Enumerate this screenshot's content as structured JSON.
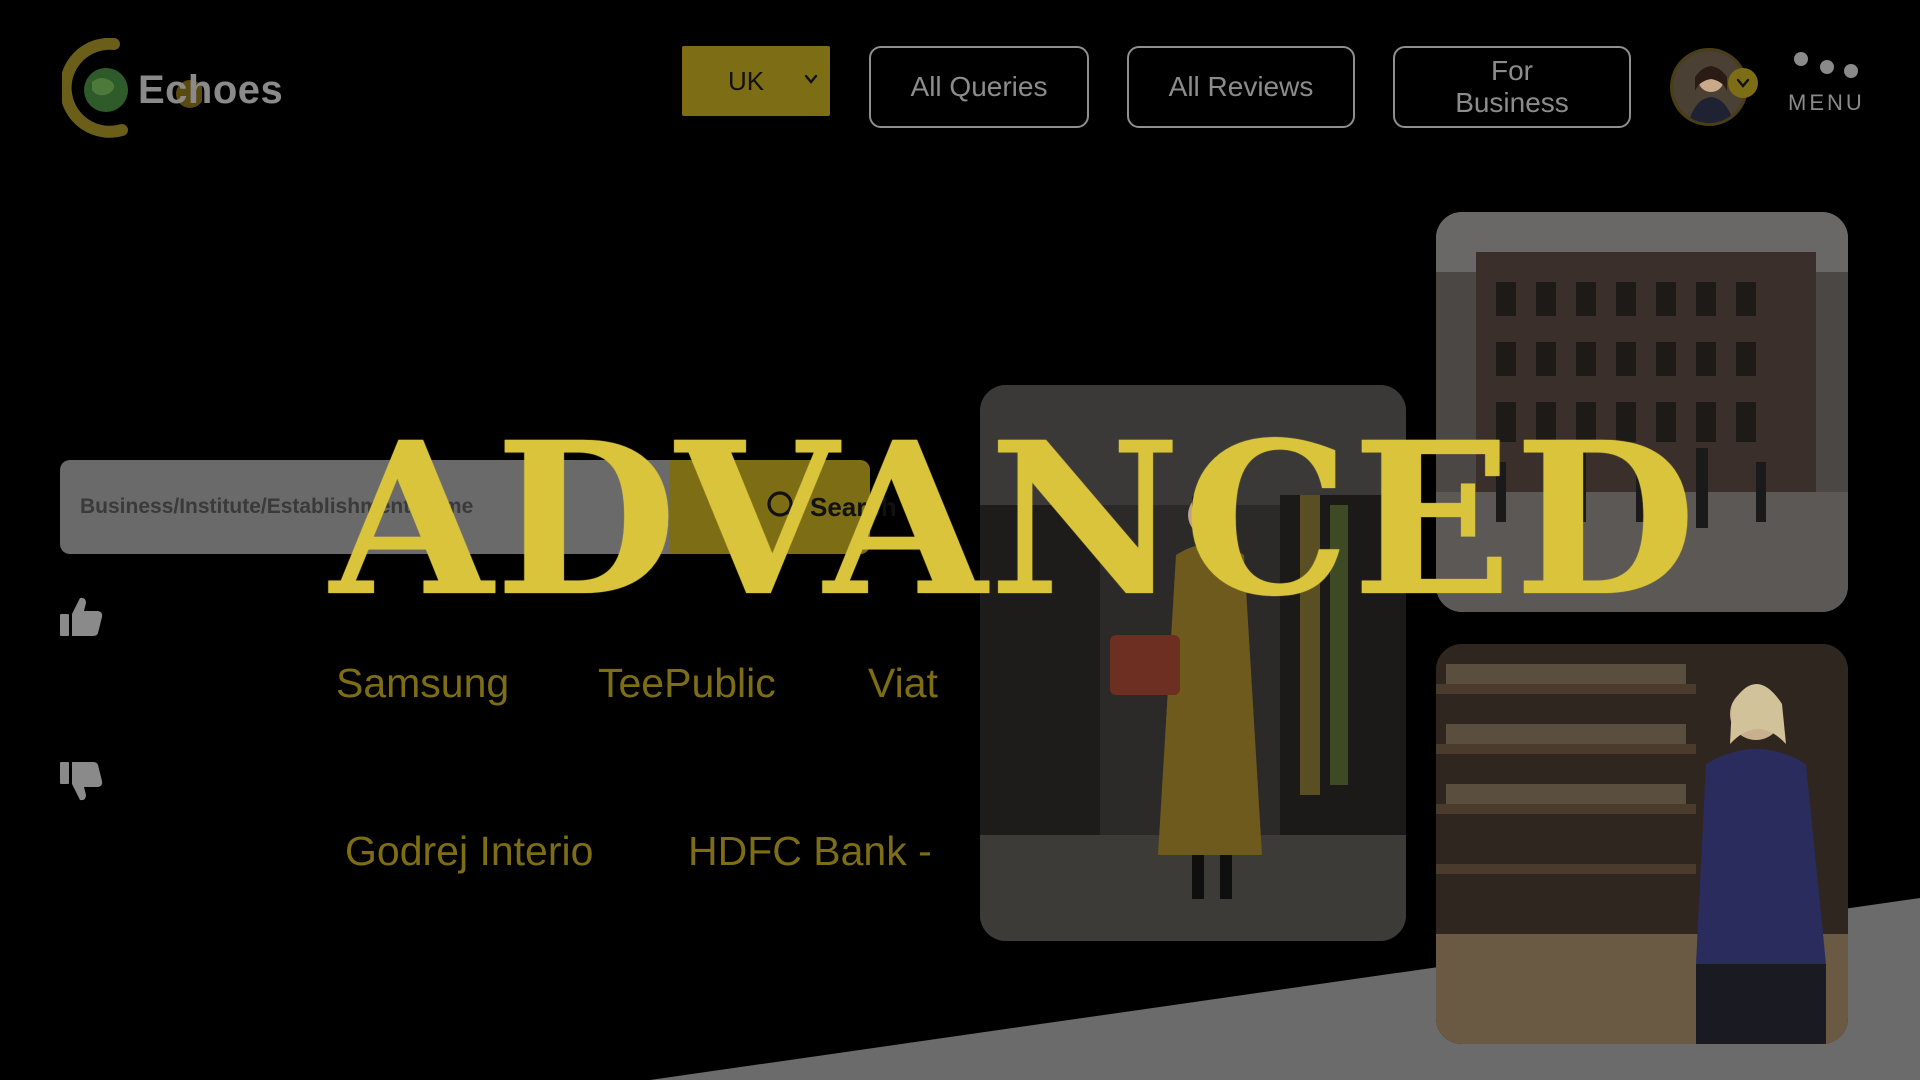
{
  "header": {
    "logo_text": "Echoes",
    "country": {
      "selected": "UK"
    },
    "nav": {
      "all_queries": "All Queries",
      "all_reviews": "All Reviews",
      "for_business": "For Business"
    },
    "menu_label": "MENU"
  },
  "search": {
    "placeholder": "Business/Institute/Establishment Name",
    "button_label": "Search"
  },
  "businesses": {
    "liked": [
      "Samsung",
      "TeePublic",
      "Viat"
    ],
    "disliked": [
      "Godrej Interio",
      "HDFC Bank -"
    ]
  },
  "overlay_word": "ADVANCED",
  "colors": {
    "accent": "#7d6d14",
    "hero": "#d9c43c",
    "band": "#6b6b6b"
  },
  "icons": [
    "logo-globe-icon",
    "chevron-down-icon",
    "search-icon",
    "thumbs-up-icon",
    "thumbs-down-icon",
    "menu-dots-icon"
  ]
}
